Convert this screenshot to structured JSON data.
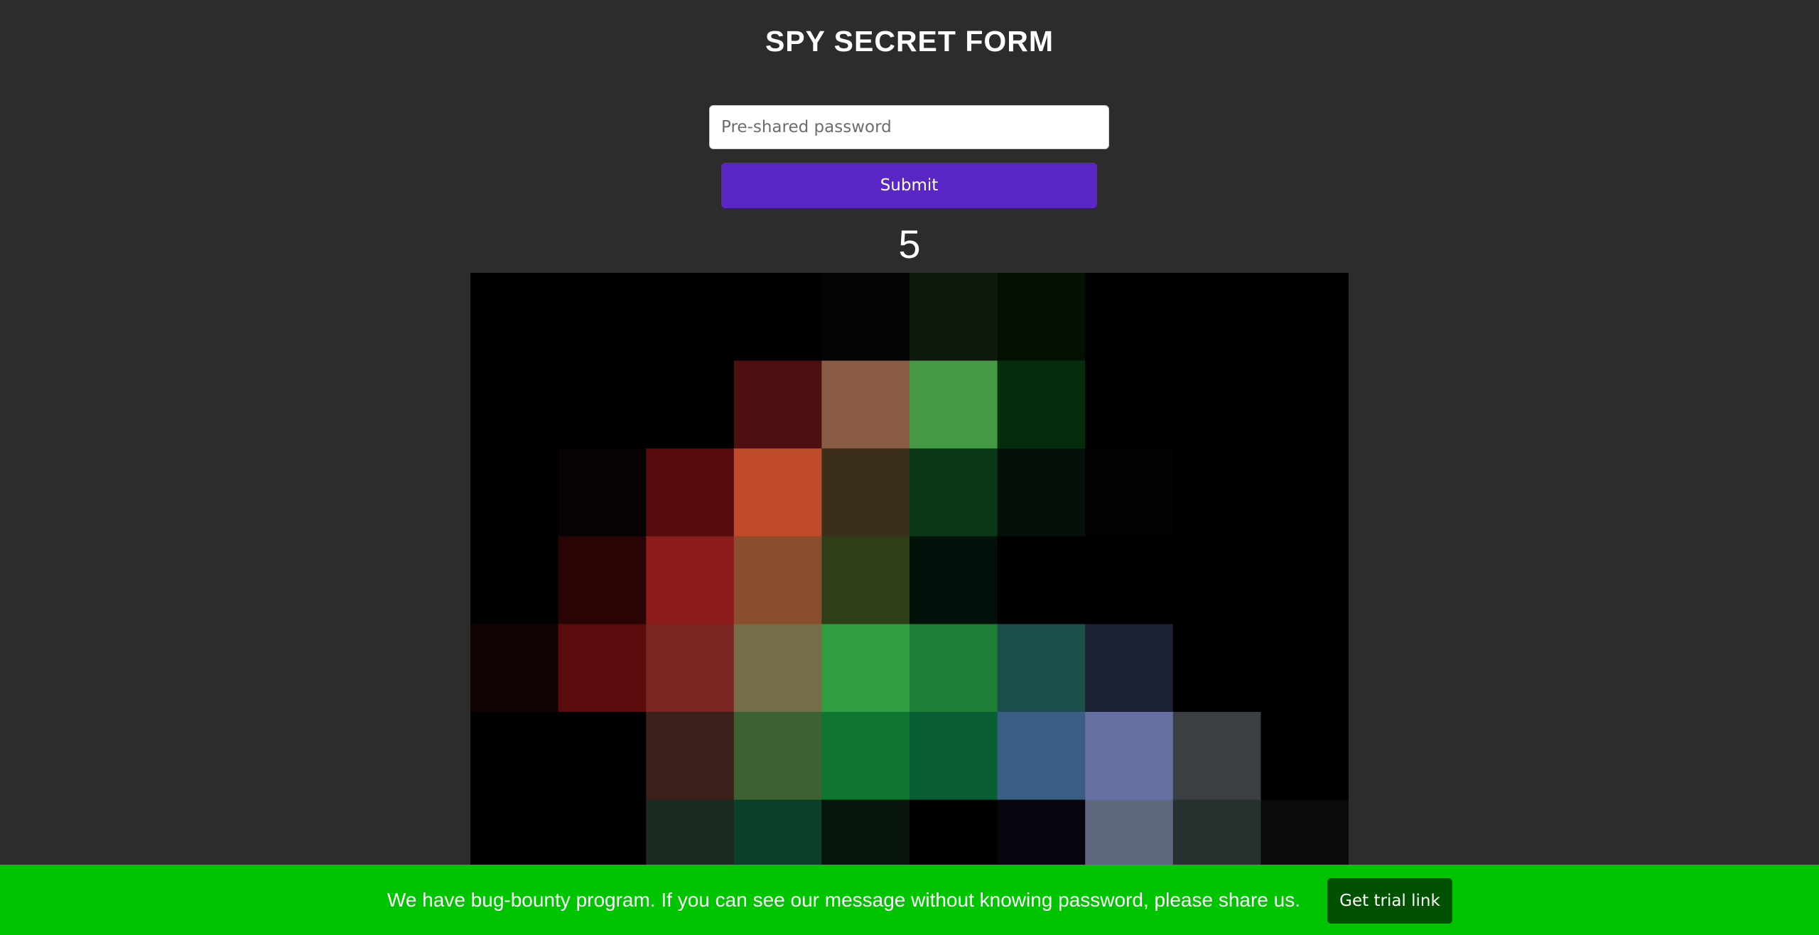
{
  "header": {
    "title": "SPY SECRET FORM"
  },
  "form": {
    "password_placeholder": "Pre-shared password",
    "password_value": "",
    "submit_label": "Submit"
  },
  "countdown": {
    "value": "5"
  },
  "pixel_image": {
    "columns": 10,
    "rows": 7,
    "cells": [
      [
        "#000000",
        "#000000",
        "#000000",
        "#000000",
        "#060306",
        "#0d1a0d",
        "#041004",
        "#000000",
        "#000000",
        "#000000"
      ],
      [
        "#000000",
        "#000000",
        "#000000",
        "#4e0f12",
        "#8a5c45",
        "#469a46",
        "#062c0e",
        "#000000",
        "#000000",
        "#000000"
      ],
      [
        "#000000",
        "#080202",
        "#560a0c",
        "#bf4b2a",
        "#3b2f1c",
        "#0a3816",
        "#060f08",
        "#010302",
        "#000000",
        "#000000"
      ],
      [
        "#000000",
        "#2a0304",
        "#8c1b1b",
        "#8a4e2e",
        "#2e3e16",
        "#02120a",
        "#000000",
        "#000000",
        "#000000",
        "#000000"
      ],
      [
        "#110202",
        "#5b0b0b",
        "#7b2523",
        "#736e48",
        "#2e9e3e",
        "#1e7e36",
        "#1c4e4a",
        "#1c2233",
        "#000000",
        "#000000"
      ],
      [
        "#000000",
        "#000000",
        "#3c211b",
        "#3c6234",
        "#0e7630",
        "#0a5e34",
        "#3a5e84",
        "#6670a2",
        "#3a3f44",
        "#000000"
      ],
      [
        "#000000",
        "#000000",
        "#1a2a1e",
        "#0c3e2a",
        "#071409",
        "#000000",
        "#07050d",
        "#5e687e",
        "#283030",
        "#0a0c0c"
      ]
    ]
  },
  "banner": {
    "message": "We have bug-bounty program. If you can see our message without knowing password, please share us.",
    "button_label": "Get trial link",
    "background": "#00c400",
    "button_color": "#005200"
  },
  "colors": {
    "page_background": "#2c2c2c",
    "submit_button": "#5b27c4"
  }
}
